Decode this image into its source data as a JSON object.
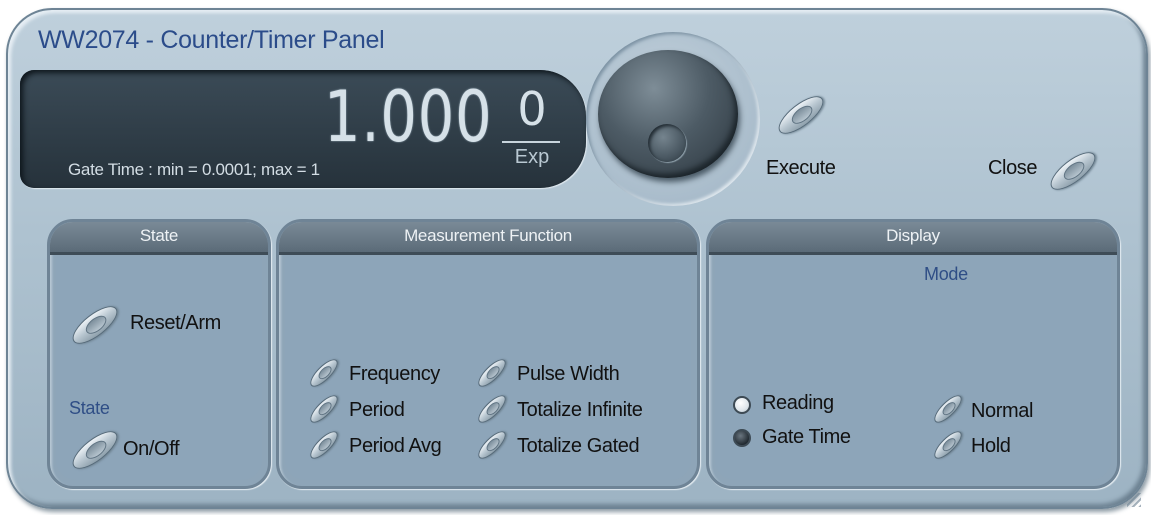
{
  "window": {
    "title": "WW2074 - Counter/Timer Panel"
  },
  "display": {
    "value": "1.000",
    "exponent": "0",
    "exponent_label": "Exp",
    "hint": "Gate Time : min = 0.0001; max = 1"
  },
  "controls": {
    "knob": "rotary-knob",
    "execute_label": "Execute",
    "close_label": "Close"
  },
  "state_group": {
    "title": "State",
    "reset_label": "Reset/Arm",
    "sub_label": "State",
    "onoff_label": "On/Off"
  },
  "measurement_group": {
    "title": "Measurement Function",
    "left_items": [
      "Frequency",
      "Period",
      "Period Avg"
    ],
    "right_items": [
      "Pulse Width",
      "Totalize Infinite",
      "Totalize Gated"
    ]
  },
  "display_group": {
    "title": "Display",
    "mode_label": "Mode",
    "radio_items": [
      {
        "label": "Reading",
        "selected": false
      },
      {
        "label": "Gate Time",
        "selected": true
      }
    ],
    "mode_items": [
      "Normal",
      "Hold"
    ]
  },
  "colors": {
    "panel": "#aec2d0",
    "title_text": "#2b4c8a",
    "lcd": "#26323b",
    "group_header": "#5b6b78"
  }
}
